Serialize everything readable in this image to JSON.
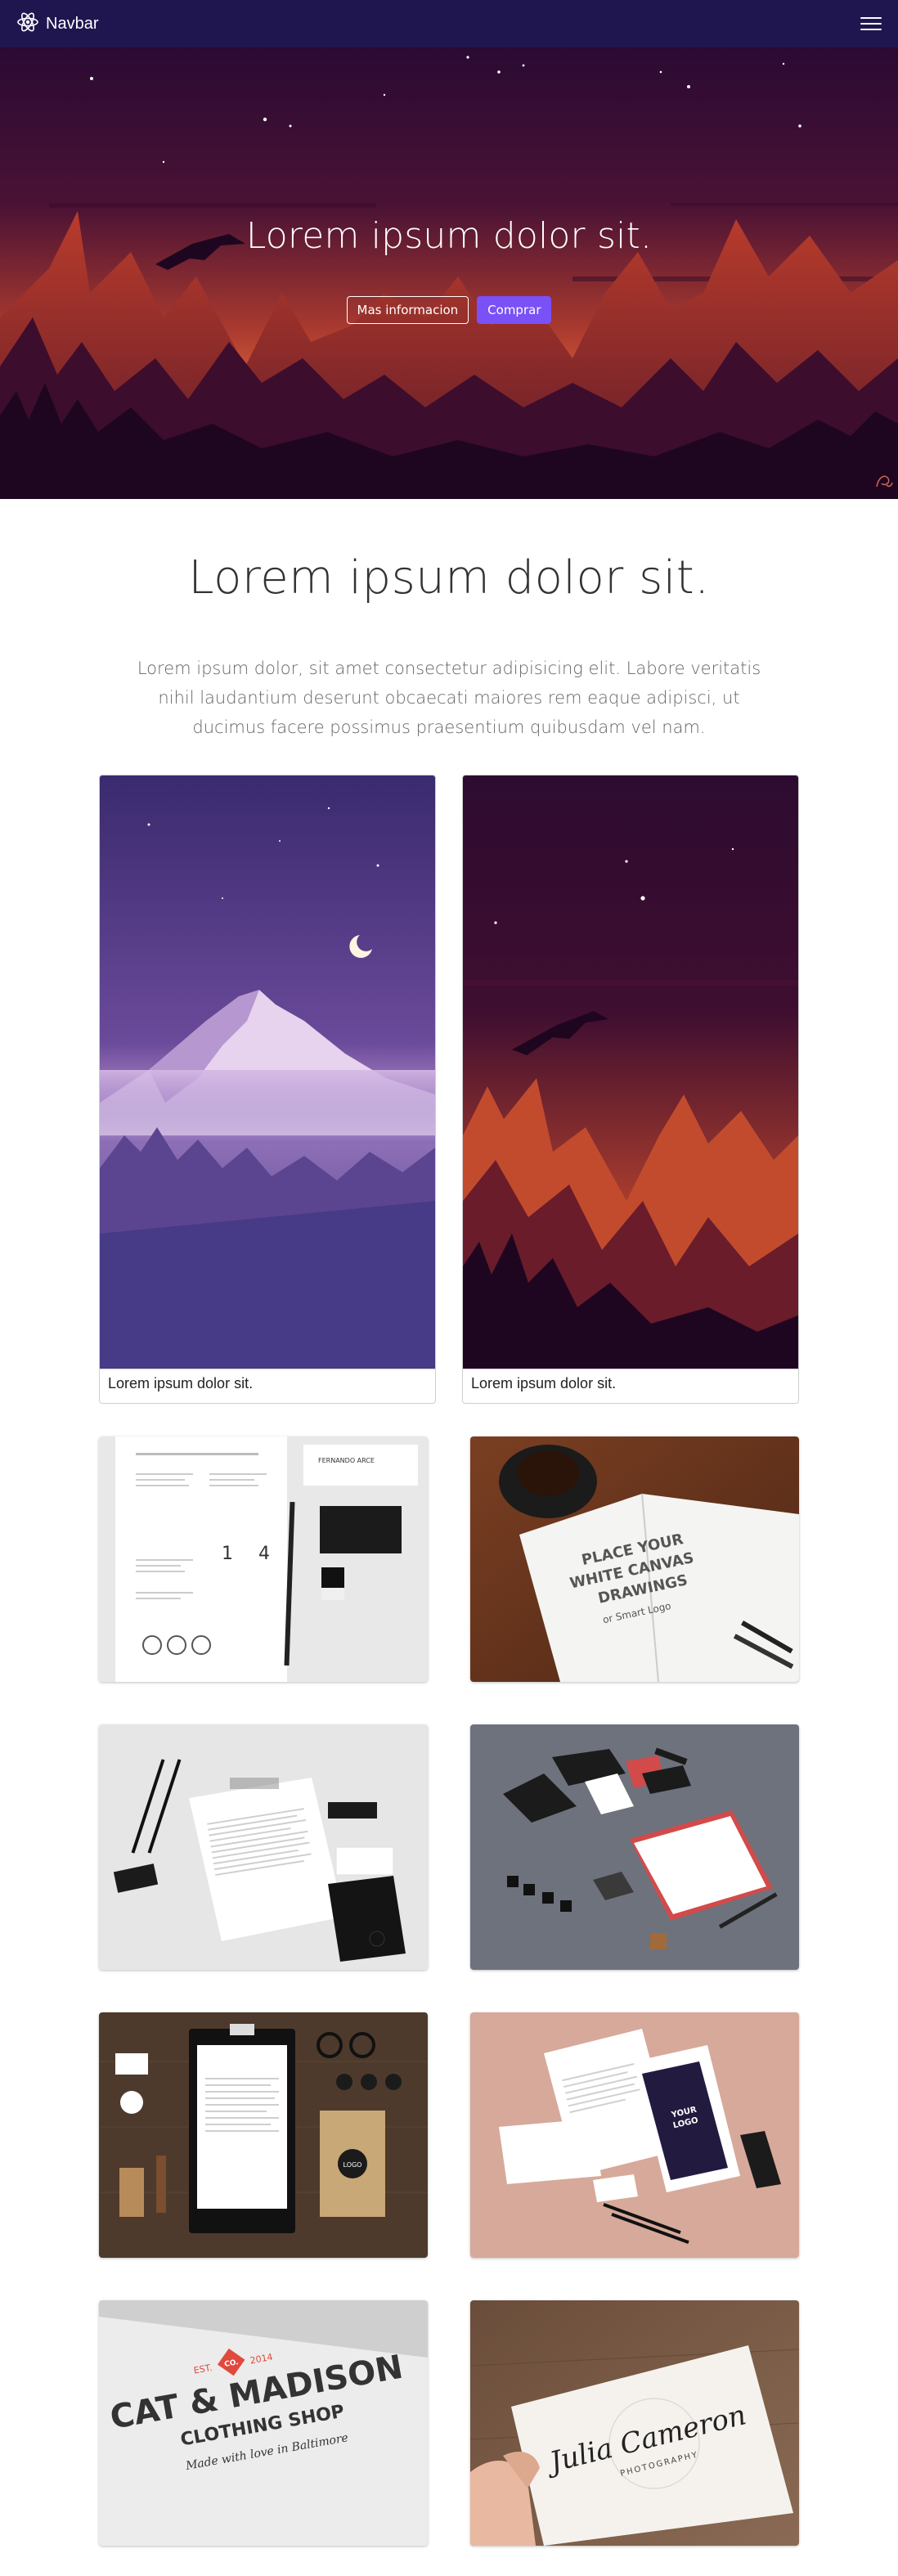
{
  "navbar": {
    "brand": "Navbar",
    "brand_icon": "react-atom-icon",
    "menu_icon": "hamburger-menu-icon"
  },
  "hero": {
    "title": "Lorem ipsum dolor sit.",
    "buttons": {
      "more_info": "Mas informacion",
      "buy": "Comprar"
    },
    "colors": {
      "sky_top": "#2a0a33",
      "glow": "#e2633a",
      "primary_button": "#7a50f7"
    }
  },
  "intro": {
    "title": "Lorem ipsum dolor sit.",
    "description": "Lorem ipsum dolor, sit amet consectetur adipisicing elit. Labore veritatis nihil laudantium deserunt obcaecati maiores rem eaque adipisci, ut ducimus facere possimus praesentium quibusdam vel nam."
  },
  "cards": [
    {
      "caption": "Lorem ipsum dolor sit.",
      "image": "purple-mountain-moon-illustration"
    },
    {
      "caption": "Lorem ipsum dolor sit.",
      "image": "red-mountains-eagle-illustration"
    }
  ],
  "gallery": {
    "tile_1": {
      "image": "resume-stationery-mockup",
      "text": {
        "name": "FERNANDO ARCE",
        "num1": "1",
        "num2": "4"
      }
    },
    "tile_2": {
      "image": "sketchbook-coffee-mockup",
      "text": {
        "line1": "PLACE YOUR",
        "line2": "WHITE CANVAS",
        "line3": "DRAWINGS",
        "line4": "or Smart Logo"
      }
    },
    "tile_3": {
      "image": "black-white-stationery-mockup"
    },
    "tile_4": {
      "image": "red-black-stationery-mockup"
    },
    "tile_5": {
      "image": "wood-clipboard-stationery-mockup",
      "text": {
        "badge": "LOGO"
      }
    },
    "tile_6": {
      "image": "pink-stationery-mockup",
      "text": {
        "logo_line1": "YOUR",
        "logo_line2": "LOGO"
      }
    },
    "tile_7": {
      "image": "cat-madison-logo-mockup",
      "text": {
        "est": "EST.",
        "co": "CO.",
        "year": "2014",
        "name": "CAT & MADISON",
        "shop": "CLOTHING SHOP",
        "tag": "Made with love in Baltimore"
      }
    },
    "tile_8": {
      "image": "julia-cameron-business-card",
      "text": {
        "name": "Julia Cameron",
        "sub": "PHOTOGRAPHY"
      }
    }
  }
}
